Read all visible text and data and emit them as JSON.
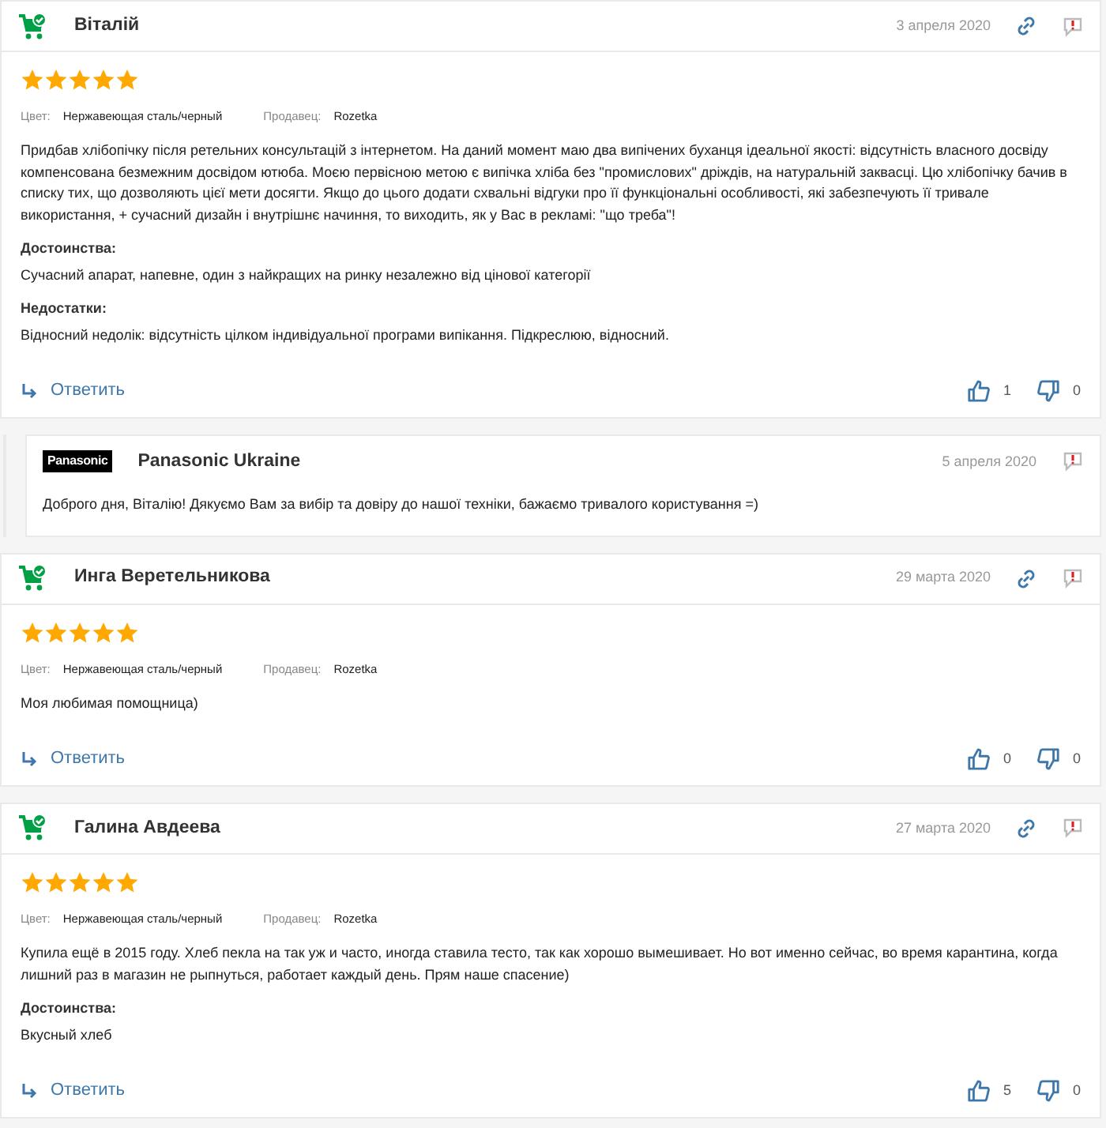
{
  "reviews": [
    {
      "kind": "review",
      "author": "Віталій",
      "date": "3 апреля 2020",
      "stars": 5,
      "attributes": [
        {
          "label": "Цвет:",
          "value": "Нержавеющая сталь/черный"
        },
        {
          "label": "Продавец:",
          "value": "Rozetka"
        }
      ],
      "text": "Придбав хлібопічку після ретельних консультацій з інтернетом. На даний момент маю два випічених буханця ідеальної якості: відсутність власного досвіду компенсована безмежним досвідом ютюба. Моєю первісною метою є випічка хліба без \"промислових\" дріждів, на натуральній заквасці. Цю хлібопічку бачив в списку тих, що дозволяють цієї мети досягти. Якщо до цього додати схвальні відгуки про її функціональні особливості, які забезпечують її тривале використання, + сучасний дизайн і внутрішнє начиння, то виходить, як у Вас в рекламі: \"що треба\"!",
      "sections": [
        {
          "heading": "Достоинства:",
          "text": "Сучасний апарат, напевне, один з найкращих на ринку незалежно від цінової категорії"
        },
        {
          "heading": "Недостатки:",
          "text": "Відносний недолік: відсутність цілком індивідуальної програми випікання. Підкреслюю, відносний."
        }
      ],
      "reply_label": "Ответить",
      "likes": "1",
      "dislikes": "0"
    },
    {
      "kind": "seller_reply",
      "logo_text": "Panasonic",
      "author": "Panasonic Ukraine",
      "date": "5 апреля 2020",
      "text": "Доброго дня, Віталію! Дякуємо Вам за вибір та довіру до нашої техніки, бажаємо тривалого користування =)"
    },
    {
      "kind": "review",
      "author": "Инга Веретельникова",
      "date": "29 марта 2020",
      "stars": 5,
      "attributes": [
        {
          "label": "Цвет:",
          "value": "Нержавеющая сталь/черный"
        },
        {
          "label": "Продавец:",
          "value": "Rozetka"
        }
      ],
      "text": "Моя любимая помощница)",
      "reply_label": "Ответить",
      "likes": "0",
      "dislikes": "0"
    },
    {
      "kind": "review",
      "author": "Галина Авдеева",
      "date": "27 марта 2020",
      "stars": 5,
      "attributes": [
        {
          "label": "Цвет:",
          "value": "Нержавеющая сталь/черный"
        },
        {
          "label": "Продавец:",
          "value": "Rozetka"
        }
      ],
      "text": "Купила ещё в 2015 году. Хлеб пекла на так уж и часто, иногда ставила тесто, так как хорошо вымешивает. Но вот именно сейчас, во время карантина, когда лишний раз в магазин не рыпнуться, работает каждый день. Прям наше спасение)",
      "sections": [
        {
          "heading": "Достоинства:",
          "text": "Вкусный хлеб"
        }
      ],
      "reply_label": "Ответить",
      "likes": "5",
      "dislikes": "0"
    }
  ]
}
